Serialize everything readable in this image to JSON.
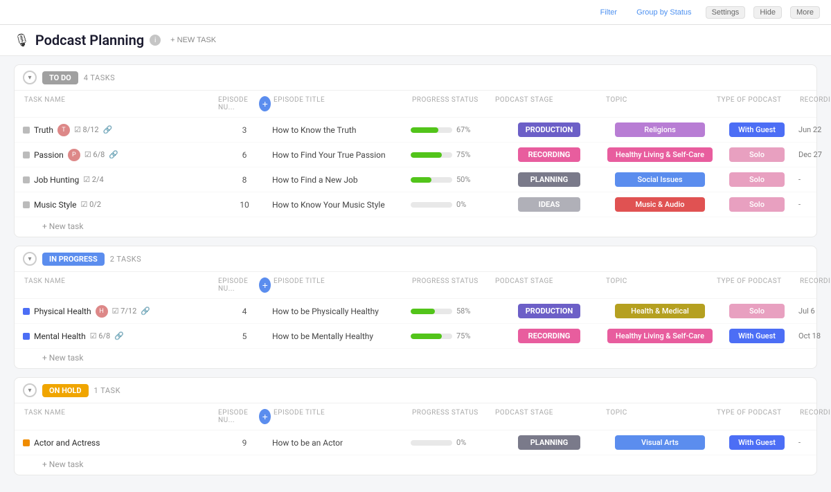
{
  "topbar": {
    "filter_label": "Filter",
    "group_by_label": "Group by Status",
    "settings_label": "Settings",
    "hide_label": "Hide",
    "more_label": "More"
  },
  "page": {
    "icon": "🎙",
    "title": "Podcast Planning",
    "new_task_label": "+ NEW TASK"
  },
  "sections": [
    {
      "id": "todo",
      "badge_label": "TO DO",
      "badge_class": "badge-todo",
      "task_count": "4 TASKS",
      "columns": [
        "TASK NAME",
        "EPISODE NU...",
        "EPISODE TITLE",
        "PROGRESS STATUS",
        "PODCAST STAGE",
        "TOPIC",
        "TYPE OF PODCAST",
        "RECORDING"
      ],
      "tasks": [
        {
          "name": "Truth",
          "dot_class": "dot-grey",
          "has_avatar": true,
          "avatar_label": "T",
          "checks": "8/12",
          "has_link": true,
          "episode_num": "3",
          "episode_title": "How to Know the Truth",
          "progress": 67,
          "stage": "PRODUCTION",
          "stage_class": "stage-production",
          "topic": "Religions",
          "topic_class": "topic-religions",
          "type": "With Guest",
          "type_class": "type-guest",
          "recording_date": "Jun 22"
        },
        {
          "name": "Passion",
          "dot_class": "dot-grey",
          "has_avatar": true,
          "avatar_label": "P",
          "checks": "6/8",
          "has_link": true,
          "episode_num": "6",
          "episode_title": "How to Find Your True Passion",
          "progress": 75,
          "stage": "RECORDING",
          "stage_class": "stage-recording",
          "topic": "Healthy Living & Self-Care",
          "topic_class": "topic-healthy",
          "type": "Solo",
          "type_class": "type-solo",
          "recording_date": "Dec 27"
        },
        {
          "name": "Job Hunting",
          "dot_class": "dot-grey",
          "has_avatar": false,
          "avatar_label": "",
          "checks": "2/4",
          "has_link": false,
          "episode_num": "8",
          "episode_title": "How to Find a New Job",
          "progress": 50,
          "stage": "PLANNING",
          "stage_class": "stage-planning",
          "topic": "Social Issues",
          "topic_class": "topic-social",
          "type": "Solo",
          "type_class": "type-solo",
          "recording_date": "-"
        },
        {
          "name": "Music Style",
          "dot_class": "dot-grey",
          "has_avatar": false,
          "avatar_label": "",
          "checks": "0/2",
          "has_link": false,
          "episode_num": "10",
          "episode_title": "How to Know Your Music Style",
          "progress": 0,
          "stage": "IDEAS",
          "stage_class": "stage-ideas",
          "topic": "Music & Audio",
          "topic_class": "topic-music",
          "type": "Solo",
          "type_class": "type-solo",
          "recording_date": "-"
        }
      ],
      "add_label": "+ New task"
    },
    {
      "id": "inprogress",
      "badge_label": "IN PROGRESS",
      "badge_class": "badge-inprogress",
      "task_count": "2 TASKS",
      "columns": [
        "TASK NAME",
        "EPISODE NU...",
        "EPISODE TITLE",
        "PROGRESS STATUS",
        "PODCAST STAGE",
        "TOPIC",
        "TYPE OF PODCAST",
        "RECORDING"
      ],
      "tasks": [
        {
          "name": "Physical Health",
          "dot_class": "dot-blue",
          "has_avatar": true,
          "avatar_label": "H",
          "checks": "7/12",
          "has_link": true,
          "episode_num": "4",
          "episode_title": "How to be Physically Healthy",
          "progress": 58,
          "stage": "PRODUCTION",
          "stage_class": "stage-production",
          "topic": "Health & Medical",
          "topic_class": "topic-health-med",
          "type": "Solo",
          "type_class": "type-solo",
          "recording_date": "Jul 6"
        },
        {
          "name": "Mental Health",
          "dot_class": "dot-blue",
          "has_avatar": false,
          "avatar_label": "",
          "checks": "6/8",
          "has_link": true,
          "episode_num": "5",
          "episode_title": "How to be Mentally Healthy",
          "progress": 75,
          "stage": "RECORDING",
          "stage_class": "stage-recording",
          "topic": "Healthy Living & Self-Care",
          "topic_class": "topic-healthy",
          "type": "With Guest",
          "type_class": "type-guest",
          "recording_date": "Oct 18"
        }
      ],
      "add_label": "+ New task"
    },
    {
      "id": "onhold",
      "badge_label": "ON HOLD",
      "badge_class": "badge-onhold",
      "task_count": "1 TASK",
      "columns": [
        "TASK NAME",
        "EPISODE NU...",
        "EPISODE TITLE",
        "PROGRESS STATUS",
        "PODCAST STAGE",
        "TOPIC",
        "TYPE OF PODCAST",
        "RECORDING"
      ],
      "tasks": [
        {
          "name": "Actor and Actress",
          "dot_class": "dot-orange",
          "has_avatar": false,
          "avatar_label": "",
          "checks": "",
          "has_link": false,
          "episode_num": "9",
          "episode_title": "How to be an Actor",
          "progress": 0,
          "stage": "PLANNING",
          "stage_class": "stage-planning",
          "topic": "Visual Arts",
          "topic_class": "topic-visual",
          "type": "With Guest",
          "type_class": "type-guest",
          "recording_date": "-"
        }
      ],
      "add_label": "+ New task"
    }
  ]
}
